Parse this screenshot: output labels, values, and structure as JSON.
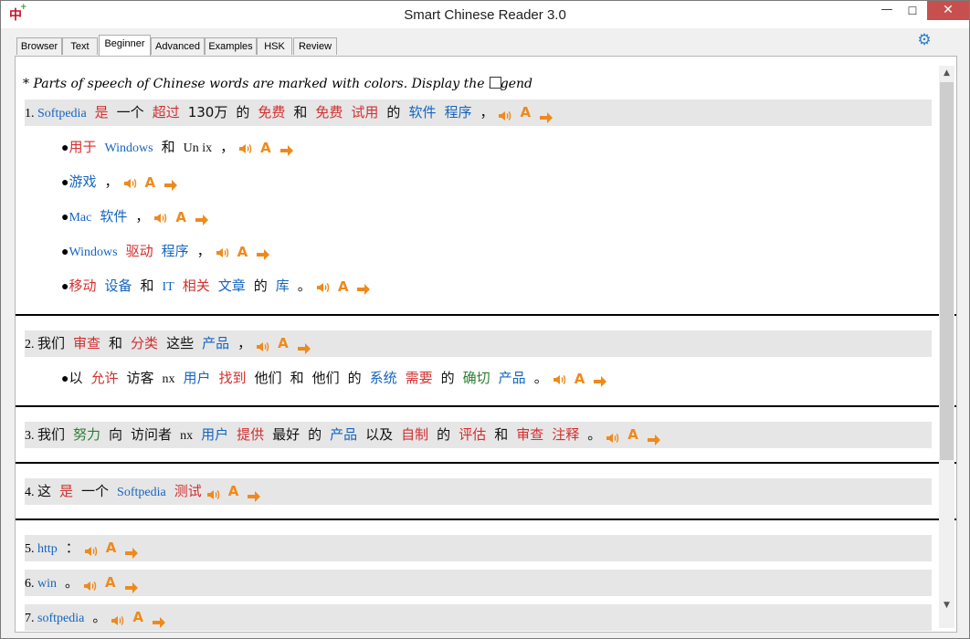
{
  "window": {
    "title": "Smart Chinese Reader 3.0",
    "app_icon": "中"
  },
  "tabs": [
    "Browser",
    "Text",
    "Beginner",
    "Advanced",
    "Examples",
    "HSK",
    "Review"
  ],
  "active_tab": "Beginner",
  "legend": {
    "text": "* Parts of speech of Chinese words are marked with colors. Display the legend",
    "checked": false
  },
  "pos_colors": {
    "noun": "#1565c0",
    "verb": "#d32f2f",
    "adjective": "#2e7d32",
    "other": "#111111"
  },
  "icon_colors": {
    "speaker": "#ee8a1c",
    "font": "#ee8a1c",
    "arrow": "#ee8a1c"
  },
  "icons": {
    "speaker": "speaker-icon",
    "font": "font-icon",
    "arrow": "arrow-right-icon",
    "settings": "gear-icon"
  },
  "font_icon_label": "A",
  "sentences": [
    {
      "number": "1.",
      "words": [
        {
          "t": "Softpedia",
          "p": "n",
          "lat": true
        },
        {
          "t": "是",
          "p": "v"
        },
        {
          "t": "一个",
          "p": "o"
        },
        {
          "t": "超过",
          "p": "v"
        },
        {
          "t": "130万",
          "p": "o"
        },
        {
          "t": "的",
          "p": "o"
        },
        {
          "t": "免费",
          "p": "v"
        },
        {
          "t": "和",
          "p": "o"
        },
        {
          "t": "免费",
          "p": "v"
        },
        {
          "t": "试用",
          "p": "v"
        },
        {
          "t": "的",
          "p": "o"
        },
        {
          "t": "软件",
          "p": "n"
        },
        {
          "t": "程序",
          "p": "n"
        },
        {
          "t": "，",
          "p": "o"
        }
      ],
      "bullets": [
        {
          "words": [
            {
              "t": "用于",
              "p": "v"
            },
            {
              "t": "Windows",
              "p": "n",
              "lat": true
            },
            {
              "t": "和",
              "p": "o"
            },
            {
              "t": "Un ix",
              "p": "o",
              "lat": true
            },
            {
              "t": "，",
              "p": "o"
            }
          ]
        },
        {
          "words": [
            {
              "t": "游戏",
              "p": "n"
            },
            {
              "t": "，",
              "p": "o"
            }
          ]
        },
        {
          "words": [
            {
              "t": "Mac",
              "p": "n",
              "lat": true
            },
            {
              "t": "软件",
              "p": "n"
            },
            {
              "t": "，",
              "p": "o"
            }
          ]
        },
        {
          "words": [
            {
              "t": "Windows",
              "p": "n",
              "lat": true
            },
            {
              "t": "驱动",
              "p": "v"
            },
            {
              "t": "程序",
              "p": "n"
            },
            {
              "t": "，",
              "p": "o"
            }
          ]
        },
        {
          "words": [
            {
              "t": "移动",
              "p": "v"
            },
            {
              "t": "设备",
              "p": "n"
            },
            {
              "t": "和",
              "p": "o"
            },
            {
              "t": "IT",
              "p": "n",
              "lat": true
            },
            {
              "t": "相关",
              "p": "v"
            },
            {
              "t": "文章",
              "p": "n"
            },
            {
              "t": "的",
              "p": "o"
            },
            {
              "t": "库",
              "p": "n"
            },
            {
              "t": "。",
              "p": "o"
            }
          ]
        }
      ]
    },
    {
      "number": "2.",
      "words": [
        {
          "t": "我们",
          "p": "o"
        },
        {
          "t": "审查",
          "p": "v"
        },
        {
          "t": "和",
          "p": "o"
        },
        {
          "t": "分类",
          "p": "v"
        },
        {
          "t": "这些",
          "p": "o"
        },
        {
          "t": "产品",
          "p": "n"
        },
        {
          "t": "，",
          "p": "o"
        }
      ],
      "bullets": [
        {
          "words": [
            {
              "t": "以",
              "p": "o"
            },
            {
              "t": "允许",
              "p": "v"
            },
            {
              "t": "访客",
              "p": "o"
            },
            {
              "t": "nx",
              "p": "o",
              "lat": true
            },
            {
              "t": "用户",
              "p": "n"
            },
            {
              "t": "找到",
              "p": "v"
            },
            {
              "t": "他们",
              "p": "o"
            },
            {
              "t": "和",
              "p": "o"
            },
            {
              "t": "他们",
              "p": "o"
            },
            {
              "t": "的",
              "p": "o"
            },
            {
              "t": "系统",
              "p": "n"
            },
            {
              "t": "需要",
              "p": "v"
            },
            {
              "t": "的",
              "p": "o"
            },
            {
              "t": "确切",
              "p": "a"
            },
            {
              "t": "产品",
              "p": "n"
            },
            {
              "t": "。",
              "p": "o"
            }
          ]
        }
      ]
    },
    {
      "number": "3.",
      "words": [
        {
          "t": "我们",
          "p": "o"
        },
        {
          "t": "努力",
          "p": "a"
        },
        {
          "t": "向",
          "p": "o"
        },
        {
          "t": "访问者",
          "p": "o"
        },
        {
          "t": "nx",
          "p": "o",
          "lat": true
        },
        {
          "t": "用户",
          "p": "n"
        },
        {
          "t": "提供",
          "p": "v"
        },
        {
          "t": "最好",
          "p": "o"
        },
        {
          "t": "的",
          "p": "o"
        },
        {
          "t": "产品",
          "p": "n"
        },
        {
          "t": "以及",
          "p": "o"
        },
        {
          "t": "自制",
          "p": "v"
        },
        {
          "t": "的",
          "p": "o"
        },
        {
          "t": "评估",
          "p": "v"
        },
        {
          "t": "和",
          "p": "o"
        },
        {
          "t": "审查",
          "p": "v"
        },
        {
          "t": "注释",
          "p": "v"
        },
        {
          "t": "。",
          "p": "o"
        }
      ],
      "bullets": []
    },
    {
      "number": "4.",
      "words": [
        {
          "t": "这",
          "p": "o"
        },
        {
          "t": "是",
          "p": "v"
        },
        {
          "t": "一个",
          "p": "o"
        },
        {
          "t": "Softpedia",
          "p": "n",
          "lat": true
        },
        {
          "t": "测试",
          "p": "v"
        }
      ],
      "bullets": []
    },
    {
      "number": "5.",
      "words": [
        {
          "t": "http",
          "p": "n",
          "lat": true
        },
        {
          "t": "：",
          "p": "o"
        }
      ],
      "bullets": []
    },
    {
      "number": "6.",
      "words": [
        {
          "t": "win",
          "p": "n",
          "lat": true
        },
        {
          "t": "。",
          "p": "o"
        }
      ],
      "bullets": []
    },
    {
      "number": "7.",
      "words": [
        {
          "t": "softpedia",
          "p": "n",
          "lat": true
        },
        {
          "t": "。",
          "p": "o"
        }
      ],
      "bullets": []
    }
  ]
}
